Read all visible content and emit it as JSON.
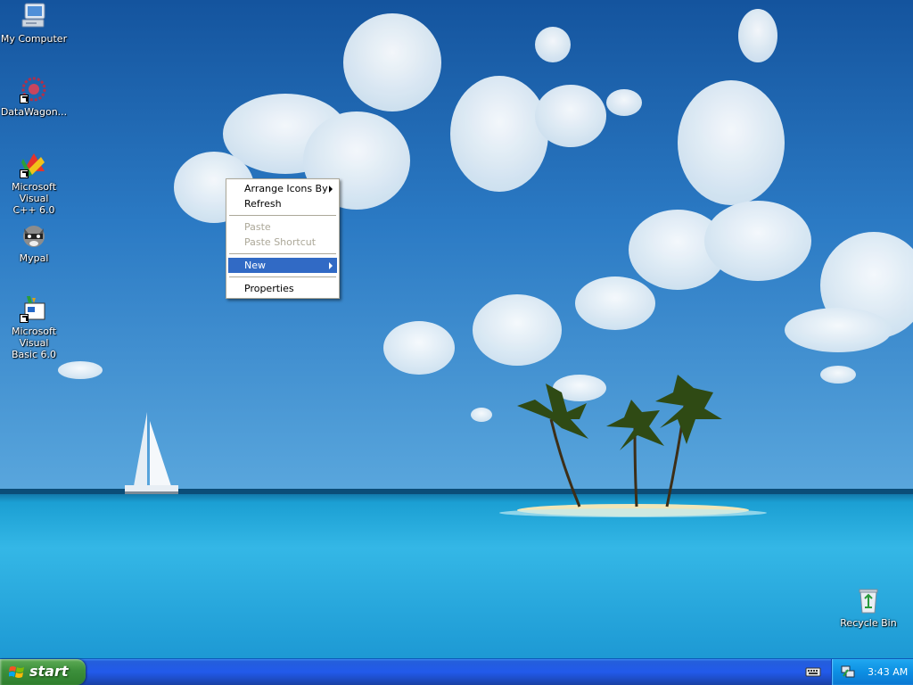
{
  "desktop": {
    "icons": [
      {
        "label": "My Computer",
        "icon": "my-computer-icon"
      },
      {
        "label": "DataWagon...",
        "icon": "datawagon-icon"
      },
      {
        "label": "Microsoft Visual\nC++ 6.0",
        "icon": "visual-cpp-icon"
      },
      {
        "label": "Mypal",
        "icon": "mypal-icon"
      },
      {
        "label": "Microsoft Visual\nBasic 6.0",
        "icon": "visual-basic-icon"
      },
      {
        "label": "Recycle Bin",
        "icon": "recycle-bin-icon"
      }
    ]
  },
  "context_menu": {
    "items": [
      {
        "label": "Arrange Icons By",
        "state": "enabled",
        "submenu": true
      },
      {
        "label": "Refresh",
        "state": "enabled",
        "submenu": false
      },
      {
        "label": "Paste",
        "state": "disabled",
        "submenu": false
      },
      {
        "label": "Paste Shortcut",
        "state": "disabled",
        "submenu": false
      },
      {
        "label": "New",
        "state": "highlighted",
        "submenu": true
      },
      {
        "label": "Properties",
        "state": "enabled",
        "submenu": false
      }
    ]
  },
  "taskbar": {
    "start_label": "start",
    "clock": "3:43 AM",
    "tray_icons": [
      "keyboard-icon",
      "network-icon"
    ]
  },
  "colors": {
    "menu_highlight": "#316ac5",
    "taskbar_blue": "#245edb",
    "start_green": "#3c8f3b",
    "disabled_text": "#aca899"
  }
}
